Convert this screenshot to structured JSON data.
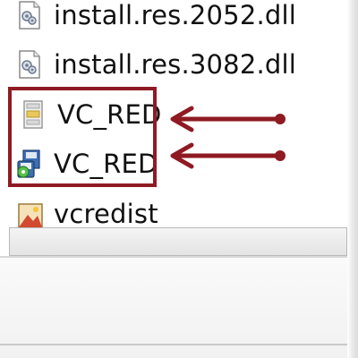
{
  "file_list": {
    "items": [
      {
        "label": "install.res.2052.dll",
        "icon": "dll-file-icon"
      },
      {
        "label": "install.res.3082.dll",
        "icon": "dll-file-icon"
      },
      {
        "label": "VC_RED",
        "icon": "cab-archive-icon"
      },
      {
        "label": "VC_RED",
        "icon": "msi-installer-icon"
      },
      {
        "label": "vcredist",
        "icon": "bitmap-image-icon"
      }
    ]
  },
  "annotation": {
    "box_color": "#8f1a22",
    "arrow_color": "#8f1a22"
  }
}
